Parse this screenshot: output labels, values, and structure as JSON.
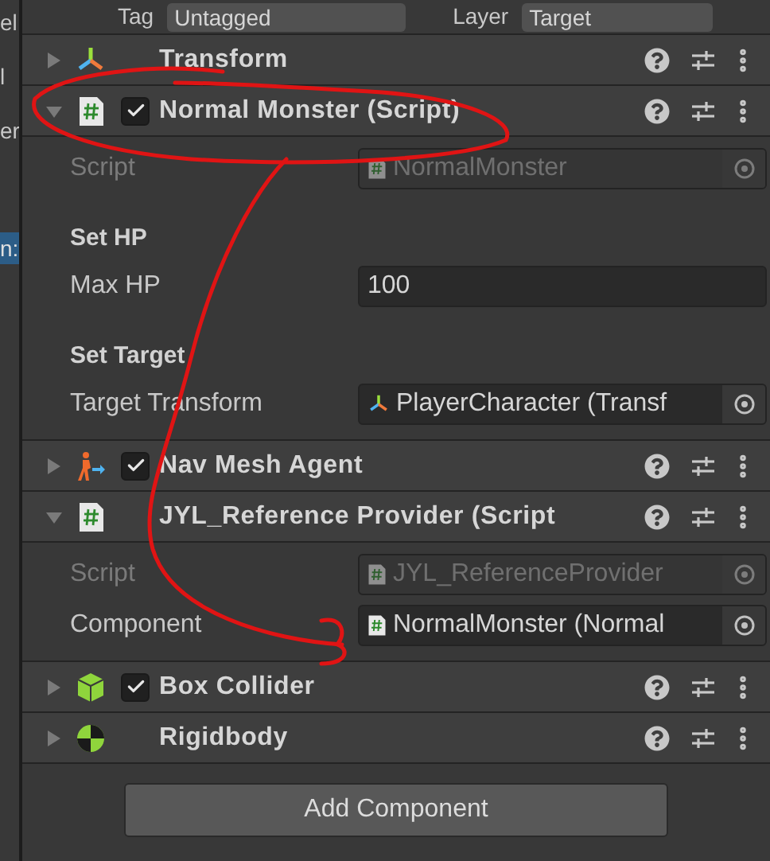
{
  "top_bar": {
    "tag_label": "Tag",
    "tag_value": "Untagged",
    "layer_label": "Layer",
    "layer_value": "Target"
  },
  "left_panel": {
    "items": [
      {
        "text": "el",
        "selected": false
      },
      {
        "text": "l",
        "selected": false
      },
      {
        "text": "er",
        "selected": false
      },
      {
        "text": "n:",
        "selected": true
      }
    ]
  },
  "components": [
    {
      "title": "Transform",
      "kind": "transform",
      "expanded": false,
      "has_checkbox": false
    },
    {
      "title": "Normal Monster (Script)",
      "kind": "script",
      "expanded": true,
      "has_checkbox": true,
      "checked": true,
      "fields": [
        {
          "kind": "script_ref",
          "label": "Script",
          "value": "NormalMonster",
          "disabled": true
        },
        {
          "kind": "heading",
          "label": "Set HP"
        },
        {
          "kind": "text",
          "label": "Max HP",
          "value": "100",
          "disabled": false
        },
        {
          "kind": "heading",
          "label": "Set Target"
        },
        {
          "kind": "transform_ref",
          "label": "Target Transform",
          "value": "PlayerCharacter (Transf",
          "disabled": false
        }
      ]
    },
    {
      "title": "Nav Mesh Agent",
      "kind": "navmesh",
      "expanded": false,
      "has_checkbox": true,
      "checked": true
    },
    {
      "title": "JYL_Reference Provider (Script",
      "kind": "script",
      "expanded": true,
      "has_checkbox": false,
      "fields": [
        {
          "kind": "script_ref",
          "label": "Script",
          "value": "JYL_ReferenceProvider",
          "disabled": true
        },
        {
          "kind": "script_ref",
          "label": "Component",
          "value": "NormalMonster (Normal",
          "disabled": false
        }
      ]
    },
    {
      "title": "Box Collider",
      "kind": "box",
      "expanded": false,
      "has_checkbox": true,
      "checked": true
    },
    {
      "title": "Rigidbody",
      "kind": "rigidbody",
      "expanded": false,
      "has_checkbox": false
    }
  ],
  "add_button": "Add Component"
}
